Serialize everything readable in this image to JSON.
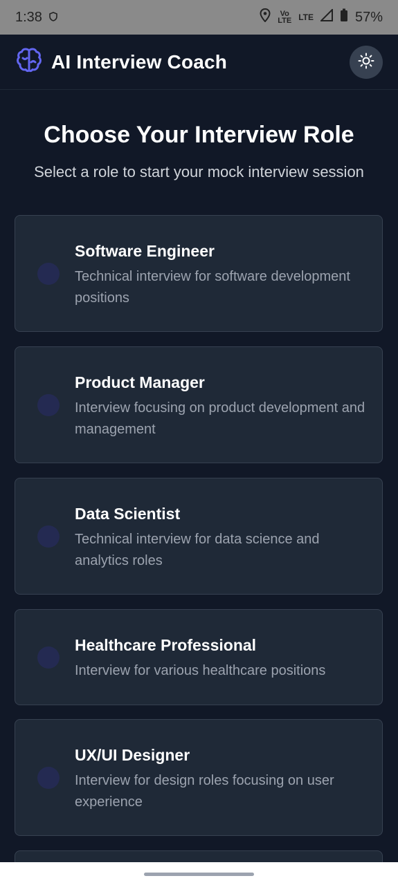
{
  "status": {
    "time": "1:38",
    "lte_top": "LTE",
    "volte": "Vo",
    "lte_small": "LTE",
    "battery": "57%"
  },
  "app": {
    "title": "AI Interview Coach",
    "logo_icon": "brain-icon",
    "theme_icon": "sun-icon"
  },
  "page": {
    "heading": "Choose Your Interview Role",
    "subheading": "Select a role to start your mock interview session"
  },
  "roles": [
    {
      "title": "Software Engineer",
      "desc": "Technical interview for software development positions"
    },
    {
      "title": "Product Manager",
      "desc": "Interview focusing on product development and management"
    },
    {
      "title": "Data Scientist",
      "desc": "Technical interview for data science and analytics roles"
    },
    {
      "title": "Healthcare Professional",
      "desc": "Interview for various healthcare positions"
    },
    {
      "title": "UX/UI Designer",
      "desc": "Interview for design roles focusing on user experience"
    }
  ],
  "colors": {
    "background": "#111827",
    "card": "#1f2937",
    "accent": "#6366f1"
  }
}
